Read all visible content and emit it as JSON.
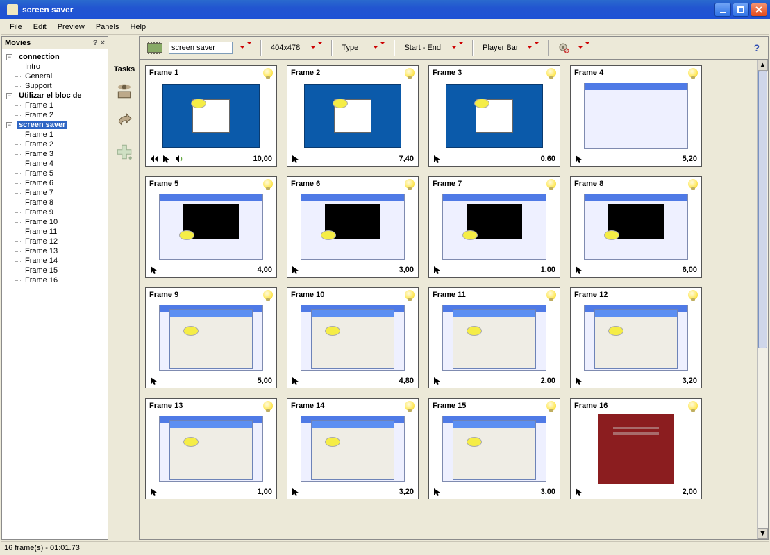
{
  "window": {
    "title": "screen saver"
  },
  "menubar": [
    "File",
    "Edit",
    "Preview",
    "Panels",
    "Help"
  ],
  "sidepanel": {
    "title": "Movies"
  },
  "tree": {
    "connection": {
      "label": "connection",
      "children": [
        "Intro",
        "General",
        "Support"
      ]
    },
    "bloc": {
      "label": "Utilizar el bloc de",
      "children": [
        "Frame 1",
        "Frame 2"
      ]
    },
    "screensaver": {
      "label": "screen saver",
      "selected": true,
      "children": [
        "Frame 1",
        "Frame 2",
        "Frame 3",
        "Frame 4",
        "Frame 5",
        "Frame 6",
        "Frame 7",
        "Frame 8",
        "Frame 9",
        "Frame 10",
        "Frame 11",
        "Frame 12",
        "Frame 13",
        "Frame 14",
        "Frame 15",
        "Frame 16"
      ]
    }
  },
  "tasks": {
    "label": "Tasks"
  },
  "toolbar": {
    "movie_name": "screen saver",
    "size": "404x478",
    "type": "Type",
    "startend": "Start - End",
    "playerbar": "Player Bar"
  },
  "frames": [
    {
      "title": "Frame 1",
      "dur": "10,00",
      "thumb": "blue",
      "footicons": [
        "rewind",
        "cursor",
        "sound"
      ]
    },
    {
      "title": "Frame 2",
      "dur": "7,40",
      "thumb": "blue",
      "footicons": [
        "cursor"
      ]
    },
    {
      "title": "Frame 3",
      "dur": "0,60",
      "thumb": "blue",
      "footicons": [
        "cursor"
      ]
    },
    {
      "title": "Frame 4",
      "dur": "5,20",
      "thumb": "win",
      "footicons": [
        "cursor"
      ]
    },
    {
      "title": "Frame 5",
      "dur": "4,00",
      "thumb": "dark",
      "footicons": [
        "cursor"
      ]
    },
    {
      "title": "Frame 6",
      "dur": "3,00",
      "thumb": "dark",
      "footicons": [
        "cursor"
      ]
    },
    {
      "title": "Frame 7",
      "dur": "1,00",
      "thumb": "dark",
      "footicons": [
        "cursor"
      ]
    },
    {
      "title": "Frame 8",
      "dur": "6,00",
      "thumb": "dark",
      "footicons": [
        "cursor"
      ]
    },
    {
      "title": "Frame 9",
      "dur": "5,00",
      "thumb": "dlg",
      "footicons": [
        "cursor"
      ]
    },
    {
      "title": "Frame 10",
      "dur": "4,80",
      "thumb": "dlg",
      "footicons": [
        "cursor"
      ]
    },
    {
      "title": "Frame 11",
      "dur": "2,00",
      "thumb": "dlg",
      "footicons": [
        "cursor"
      ]
    },
    {
      "title": "Frame 12",
      "dur": "3,20",
      "thumb": "dlg",
      "footicons": [
        "cursor"
      ]
    },
    {
      "title": "Frame 13",
      "dur": "1,00",
      "thumb": "dlg",
      "footicons": [
        "cursor"
      ]
    },
    {
      "title": "Frame 14",
      "dur": "3,20",
      "thumb": "dlg",
      "footicons": [
        "cursor"
      ]
    },
    {
      "title": "Frame 15",
      "dur": "3,00",
      "thumb": "dlg",
      "footicons": [
        "cursor"
      ]
    },
    {
      "title": "Frame 16",
      "dur": "2,00",
      "thumb": "red",
      "footicons": [
        "cursor"
      ]
    }
  ],
  "status": "16 frame(s) - 01:01.73"
}
